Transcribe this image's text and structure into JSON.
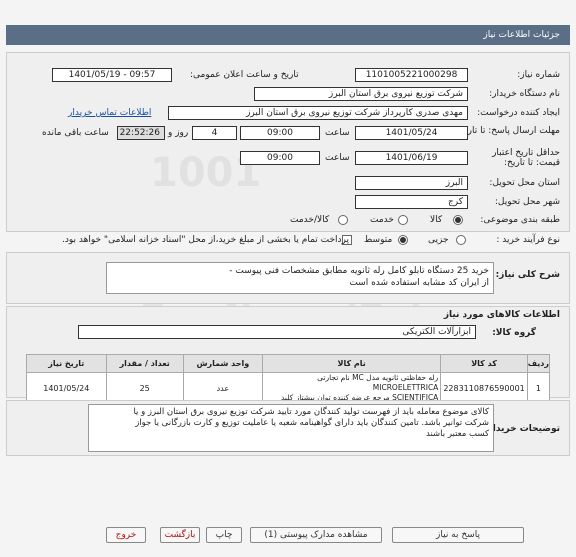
{
  "header": {
    "title": "جزئیات اطلاعات نیاز"
  },
  "form": {
    "need_number_label": "شماره نیاز:",
    "need_number": "1101005221000298",
    "announce_label": "تاریخ و ساعت اعلان عمومی:",
    "announce_value": "1401/05/19 - 09:57",
    "buyer_org_label": "نام دستگاه خریدار:",
    "buyer_org": "شرکت توزیع نیروی برق استان البرز",
    "creator_label": "ایجاد کننده درخواست:",
    "creator": "مهدی صدری کارپرداز شرکت توزیع نیروی برق استان البرز",
    "contact_link": "اطلاعات تماس خریدار",
    "deadline_label": "مهلت ارسال پاسخ: تا تاریخ:",
    "deadline_date": "1401/05/24",
    "time_label": "ساعت",
    "deadline_time": "09:00",
    "days": "4",
    "days_label": "روز و",
    "remaining_time": "22:52:26",
    "remaining_label": "ساعت باقی مانده",
    "validity_label": "حداقل تاریخ اعتبار قیمت: تا تاریخ:",
    "validity_date": "1401/06/19",
    "validity_time": "09:00",
    "province_label": "استان محل تحویل:",
    "province": "البرز",
    "city_label": "شهر محل تحویل:",
    "city": "کرج",
    "category_label": "طبقه بندی موضوعی:",
    "category_options": [
      "کالا",
      "خدمت",
      "کالا/خدمت"
    ],
    "purchase_label": "نوع فرآیند خرید :",
    "purchase_options": [
      "جزیی",
      "متوسط"
    ],
    "payment_note": "پرداخت تمام یا بخشی از مبلغ خرید،از محل \"اسناد خزانه اسلامی\" خواهد بود."
  },
  "summary": {
    "label": "شرح کلی نیاز:",
    "line1": "خرید 25 دستگاه  تابلو کامل رله  ثانویه مطابق مشخصات فنی پیوست -",
    "line2": "از ایران کد مشابه استفاده شده است"
  },
  "goods": {
    "section_title": "اطلاعات کالاهای مورد نیاز",
    "group_label": "گروه کالا:",
    "group_value": "ابزارآلات الکتریکی",
    "columns": [
      "ردیف",
      "کد کالا",
      "نام کالا",
      "واحد شمارش",
      "تعداد / مقدار",
      "تاریخ نیاز"
    ],
    "rows": [
      {
        "index": "1",
        "code": "2283110876590001",
        "name_line1": "رله حفاظتی ثانویه مدل MC نام تجارتی MICROELETTRICA",
        "name_line2": "SCIENTIFICA مرجع عرضه کننده توان پیشتاز کلید",
        "unit": "عدد",
        "qty": "25",
        "date": "1401/05/24"
      }
    ]
  },
  "buyer_notes": {
    "label": "توضیحات خریدار:",
    "line1": "کالای موضوع معامله باید از فهرست تولید کنندگان مورد تایید شرکت توزیع نیروی برق استان البرز و یا",
    "line2": "شرکت توانیر باشد. تامین کنندگان باید دارای گواهینامه شعبه یا عاملیت توزیع و کارت بازرگانی یا جواز",
    "line3": "کسب معتبر باشند"
  },
  "watermark": {
    "line1": "ParsNamadData",
    "line2": "1001"
  },
  "buttons": {
    "reply": "پاسخ به نیاز",
    "attachments": "مشاهده مدارک پیوستی (1)",
    "print": "چاپ",
    "back": "بازگشت",
    "exit": "خروج"
  }
}
